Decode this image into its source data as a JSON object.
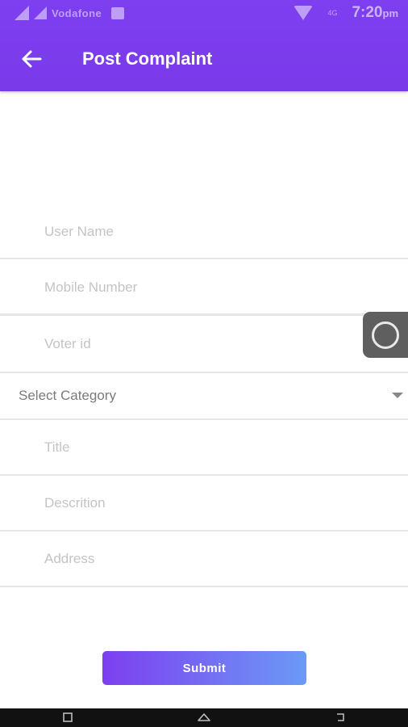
{
  "status_bar": {
    "carrier": "Vodafone",
    "network": "4G",
    "time": "7:20",
    "time_suffix": "pm"
  },
  "header": {
    "title": "Post Complaint",
    "back_icon": "arrow-left-icon"
  },
  "form": {
    "user_name": {
      "placeholder": "User Name",
      "value": ""
    },
    "mobile_number": {
      "placeholder": "Mobile Number",
      "value": ""
    },
    "voter_id": {
      "placeholder": "Voter id",
      "value": ""
    },
    "category": {
      "label": "Select Category",
      "icon": "dropdown-arrow-icon"
    },
    "title": {
      "placeholder": "Title",
      "value": ""
    },
    "description": {
      "placeholder": "Descrition",
      "value": ""
    },
    "address": {
      "placeholder": "Address",
      "value": ""
    },
    "submit_label": "Submit"
  },
  "colors": {
    "app_bar": "#7c3aed",
    "submit_gradient_start": "#7d3ff0",
    "submit_gradient_end": "#6b9af6",
    "divider": "#e6e6e6",
    "floating_button": "#5f5f5f",
    "nav_bar": "#111111"
  },
  "nav_bar": {
    "items": [
      "recent-apps-icon",
      "home-icon",
      "back-icon"
    ]
  }
}
